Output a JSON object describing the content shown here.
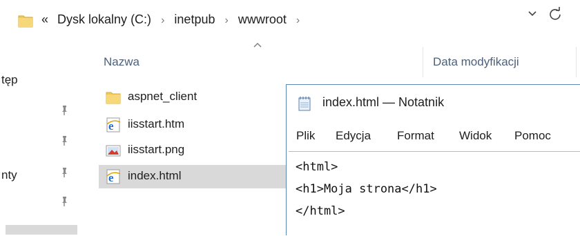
{
  "colors": {
    "folder": "#f0c85a",
    "selection": "#d9d9d9",
    "header_text": "#4c607a",
    "window_border": "#5a86b8",
    "ie_icon": "#1e6fd0"
  },
  "address_bar": {
    "overflow_marker": "«",
    "breadcrumbs": [
      "Dysk lokalny (C:)",
      "inetpub",
      "wwwroot"
    ],
    "separator": "›",
    "icons": [
      "folder-icon",
      "dropdown-icon",
      "refresh-icon"
    ]
  },
  "nav_pane": {
    "items": [
      {
        "label": "tęp",
        "pinned": false
      },
      {
        "label": "",
        "pinned": true
      },
      {
        "label": "",
        "pinned": true
      },
      {
        "label": "nty",
        "pinned": true
      },
      {
        "label": "",
        "pinned": true
      }
    ]
  },
  "file_list": {
    "columns": {
      "name": "Nazwa",
      "modified": "Data modyfikacji"
    },
    "sort_indicator": "sort-ascending-icon",
    "files": [
      {
        "name": "aspnet_client",
        "icon": "folder-icon",
        "selected": false
      },
      {
        "name": "iisstart.htm",
        "icon": "ie-html-icon",
        "selected": false
      },
      {
        "name": "iisstart.png",
        "icon": "image-icon",
        "selected": false
      },
      {
        "name": "index.html",
        "icon": "ie-html-icon",
        "selected": true
      }
    ]
  },
  "notepad": {
    "title": "index.html — Notatnik",
    "menu": [
      "Plik",
      "Edycja",
      "Format",
      "Widok",
      "Pomoc"
    ],
    "content_lines": [
      "<html>",
      "<h1>Moja strona</h1>",
      "</html>"
    ]
  }
}
